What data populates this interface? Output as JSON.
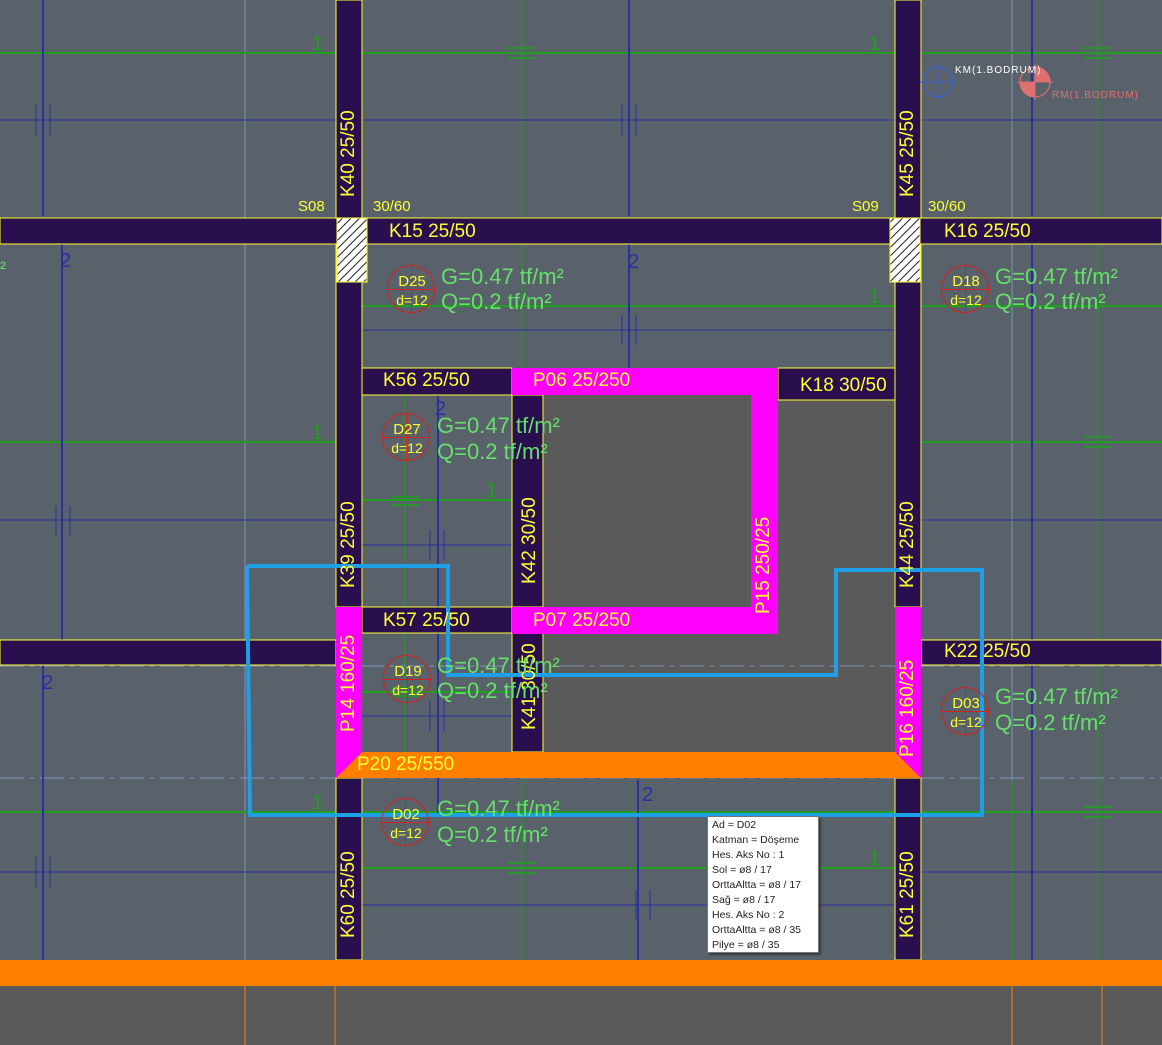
{
  "beams": {
    "k40": "K40 25/50",
    "k45": "K45 25/50",
    "k15": "K15 25/50",
    "k16": "K16 25/50",
    "k56": "K56 25/50",
    "k18": "K18 30/50",
    "k39": "K39 25/50",
    "k42": "K42 30/50",
    "k44": "K44 25/50",
    "k57": "K57 25/50",
    "k22": "K22 25/50",
    "k41": "K41 30/50",
    "k60": "K60 25/50",
    "k61": "K61 25/50"
  },
  "columns": {
    "s08": "S08",
    "s09": "S09",
    "s08_size": "30/60",
    "s09_size": "30/60"
  },
  "shear_walls": {
    "p06": "P06 25/250",
    "p07": "P07 25/250",
    "p15": "P15 250/25",
    "p14": "P14 160/25",
    "p16": "P16 160/25",
    "p20": "P20 25/550"
  },
  "slabs": [
    {
      "name": "D25",
      "thickness": "d=12",
      "g": "G=0.47 tf/m²",
      "q": "Q=0.2 tf/m²"
    },
    {
      "name": "D18",
      "thickness": "d=12",
      "g": "G=0.47 tf/m²",
      "q": "Q=0.2 tf/m²"
    },
    {
      "name": "D27",
      "thickness": "d=12",
      "g": "G=0.47 tf/m²",
      "q": "Q=0.2 tf/m²"
    },
    {
      "name": "D19",
      "thickness": "d=12",
      "g": "G=0.47 tf/m²",
      "q": "Q=0.2 tf/m²"
    },
    {
      "name": "D03",
      "thickness": "d=12",
      "g": "G=0.47 tf/m²",
      "q": "Q=0.2 tf/m²"
    },
    {
      "name": "D02",
      "thickness": "d=12",
      "g": "G=0.47 tf/m²",
      "q": "Q=0.2 tf/m²"
    }
  ],
  "markers": {
    "km": "KM(1.BODRUM)",
    "rm": "RM(1.BODRUM)"
  },
  "axis_labels": {
    "one": "1",
    "two": "2",
    "unit": "²"
  },
  "tooltip": {
    "lines": [
      "Ad = D02",
      "Katman = Döşeme",
      "Hes. Aks No : 1",
      "Sol = ø8 / 17",
      "OrttaAltta = ø8 / 17",
      "Sağ = ø8 / 17",
      "Hes. Aks No : 2",
      "OrttaAltta = ø8 / 35",
      "Pilye = ø8 / 35"
    ]
  },
  "colors": {
    "background": "#59616a",
    "beam": "#2a0f4e",
    "shear_wall": "#ff00ff",
    "orange_wall": "#ff7f00",
    "void": "#5a5a5a",
    "axis_green": "#1ea01e",
    "axis_blue": "#2b2fa0",
    "selection": "#1ea0e6",
    "label": "#ffff33",
    "load_text": "#66e06a"
  }
}
